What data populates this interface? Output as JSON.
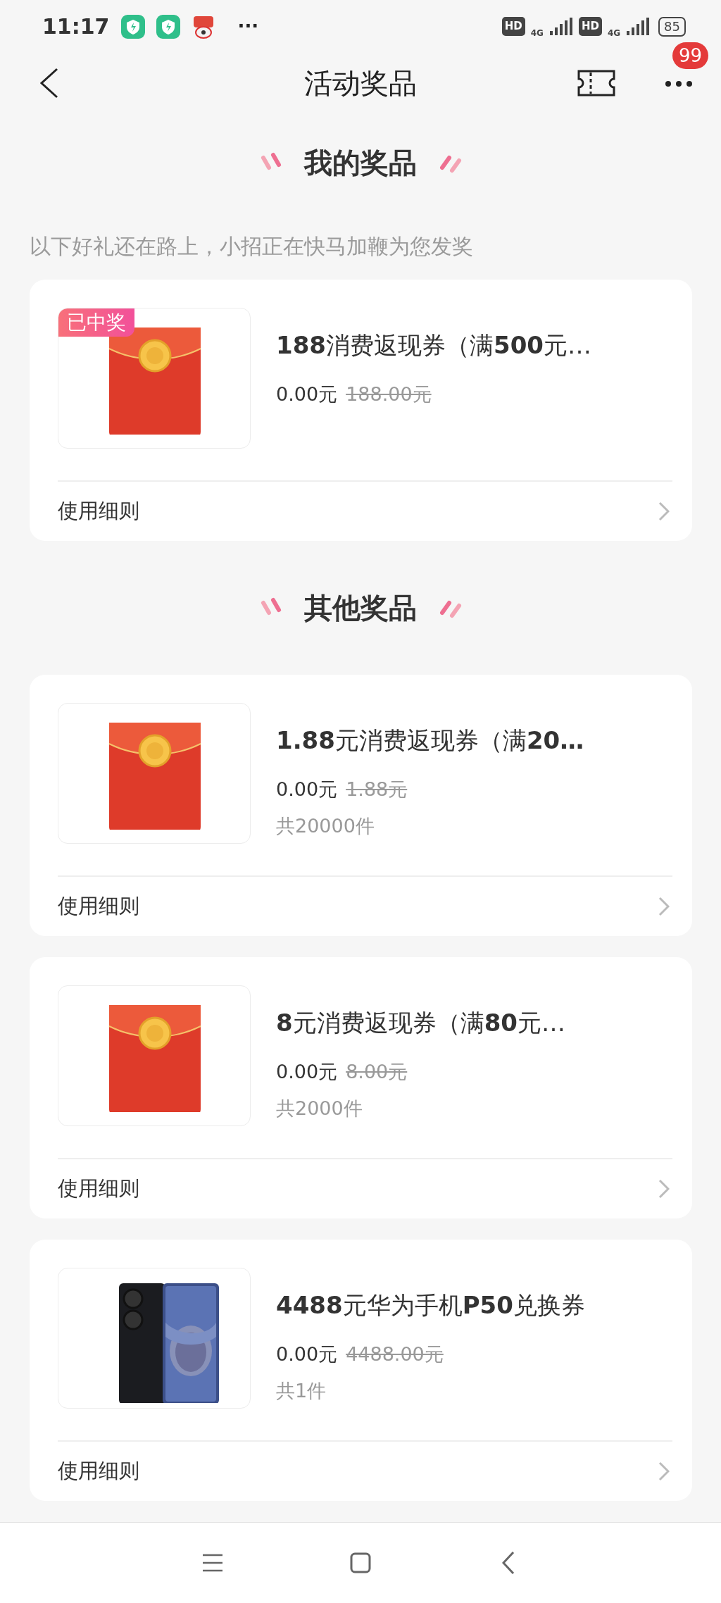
{
  "status_bar": {
    "time": "11:17",
    "more": "···",
    "network": [
      {
        "hd": "HD",
        "type": "4G"
      },
      {
        "hd": "HD",
        "type": "4G"
      }
    ],
    "battery": "85"
  },
  "nav": {
    "title": "活动奖品",
    "badge": "99"
  },
  "sections": [
    {
      "title": "我的奖品",
      "subtitle": "以下好礼还在路上，小招正在快马加鞭为您发奖",
      "items": [
        {
          "kind": "envelope",
          "badge": "已中奖",
          "title": "**188**消费返现券（满**500**元…",
          "price": "0.00元",
          "original_price": "188.00元",
          "link": "使用细则"
        }
      ]
    },
    {
      "title": "其他奖品",
      "items": [
        {
          "kind": "envelope",
          "title": "**1.88**元消费返现券（满**20…**",
          "price": "0.00元",
          "original_price": "1.88元",
          "count": "共20000件",
          "link": "使用细则"
        },
        {
          "kind": "envelope",
          "title": "**8**元消费返现券（满**80**元…",
          "price": "0.00元",
          "original_price": "8.00元",
          "count": "共2000件",
          "link": "使用细则"
        },
        {
          "kind": "picture",
          "title": "**4488**元华为手机**P50**兑换券",
          "price": "0.00元",
          "original_price": "4488.00元",
          "count": "共1件",
          "link": "使用细则"
        }
      ]
    }
  ]
}
